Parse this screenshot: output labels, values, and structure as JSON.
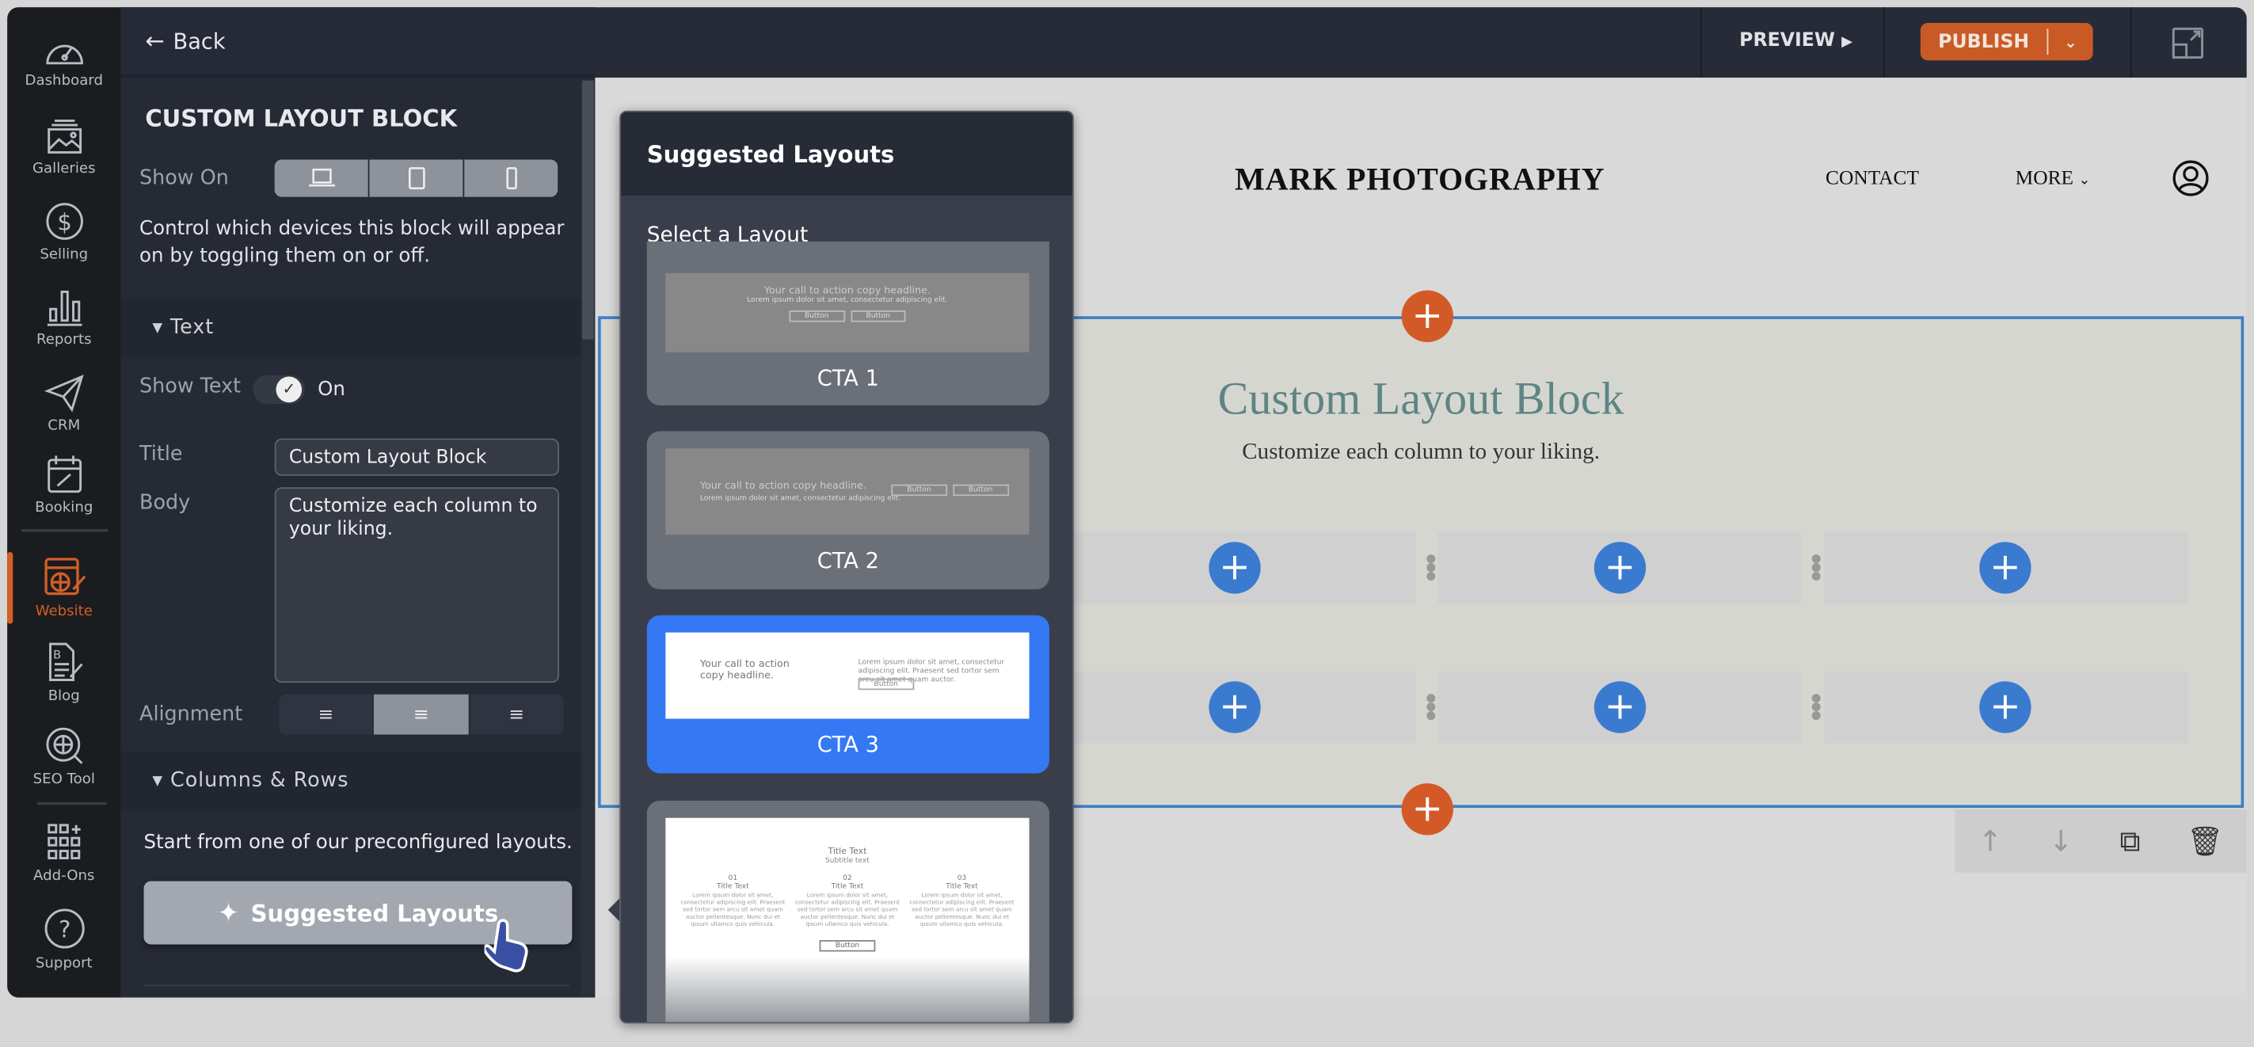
{
  "nav": {
    "items": [
      {
        "label": "Dashboard",
        "icon": "speedometer-icon"
      },
      {
        "label": "Galleries",
        "icon": "image-stack-icon"
      },
      {
        "label": "Selling",
        "icon": "dollar-circle-icon"
      },
      {
        "label": "Reports",
        "icon": "bar-chart-icon"
      },
      {
        "label": "CRM",
        "icon": "paper-plane-icon"
      },
      {
        "label": "Booking",
        "icon": "calendar-icon"
      },
      {
        "label": "Website",
        "icon": "website-edit-icon",
        "active": true
      },
      {
        "label": "Blog",
        "icon": "blog-edit-icon"
      },
      {
        "label": "SEO Tool",
        "icon": "globe-search-icon"
      },
      {
        "label": "Add-Ons",
        "icon": "grid-plus-icon"
      },
      {
        "label": "Support",
        "icon": "question-circle-icon"
      }
    ],
    "active_color": "#d35f25"
  },
  "panel": {
    "back": "Back",
    "title": "CUSTOM LAYOUT BLOCK",
    "show_on": "Show On",
    "show_on_help": "Control which devices this block will appear on by toggling them on or off.",
    "text_section": "Text",
    "show_text": "Show Text",
    "show_text_state": "On",
    "title_label": "Title",
    "title_value": "Custom Layout Block",
    "body_label": "Body",
    "body_value": "Customize each column to your liking.",
    "alignment": "Alignment",
    "alignment_selected": "center",
    "columns_section": "Columns & Rows",
    "columns_help": "Start from one of our preconfigured layouts.",
    "suggested_button": "Suggested Layouts"
  },
  "topbar": {
    "preview": "PREVIEW",
    "publish": "PUBLISH",
    "publish_color": "#c95a25"
  },
  "site": {
    "brand": "MARK PHOTOGRAPHY",
    "nav": [
      "CONTACT",
      "MORE"
    ],
    "block_title": "Custom Layout Block",
    "block_body": "Customize each column to your liking.",
    "title_color": "#5e8583",
    "selection_color": "#3f7fc6"
  },
  "popup": {
    "title": "Suggested Layouts",
    "subtitle": "Select a Layout",
    "selected": "CTA 3",
    "selected_color": "#3578f3",
    "cards": [
      {
        "label": "CTA 1",
        "headline": "Your call to action copy headline.",
        "sub": "Lorem ipsum dolor sit amet, consectetur adipiscing elit.",
        "buttons": [
          "Button",
          "Button"
        ]
      },
      {
        "label": "CTA 2",
        "headline": "Your call to action copy headline.",
        "sub": "Lorem ipsum dolor sit amet, consectetur adipiscing elit.",
        "buttons": [
          "Button",
          "Button"
        ]
      },
      {
        "label": "CTA 3",
        "headline": "Your call to action copy headline.",
        "sub": "Lorem ipsum dolor sit amet, consectetur adipiscing elit. Praesent sed tortor sem arcu sit amet quam auctor.",
        "buttons": [
          "Button"
        ]
      },
      {
        "title": "Title Text",
        "subtitle": "Subtitle text",
        "cols": [
          {
            "num": "01",
            "title": "Title Text"
          },
          {
            "num": "02",
            "title": "Title Text"
          },
          {
            "num": "03",
            "title": "Title Text"
          }
        ],
        "col_body": "Lorem ipsum dolor sit amet, consectetur adipiscing elit. Praesent sed tortor sem arcu sit amet quam auctor pellentesque. Nunc dui et ipsum ullamco quis vehicula.",
        "button": "Button"
      }
    ]
  }
}
